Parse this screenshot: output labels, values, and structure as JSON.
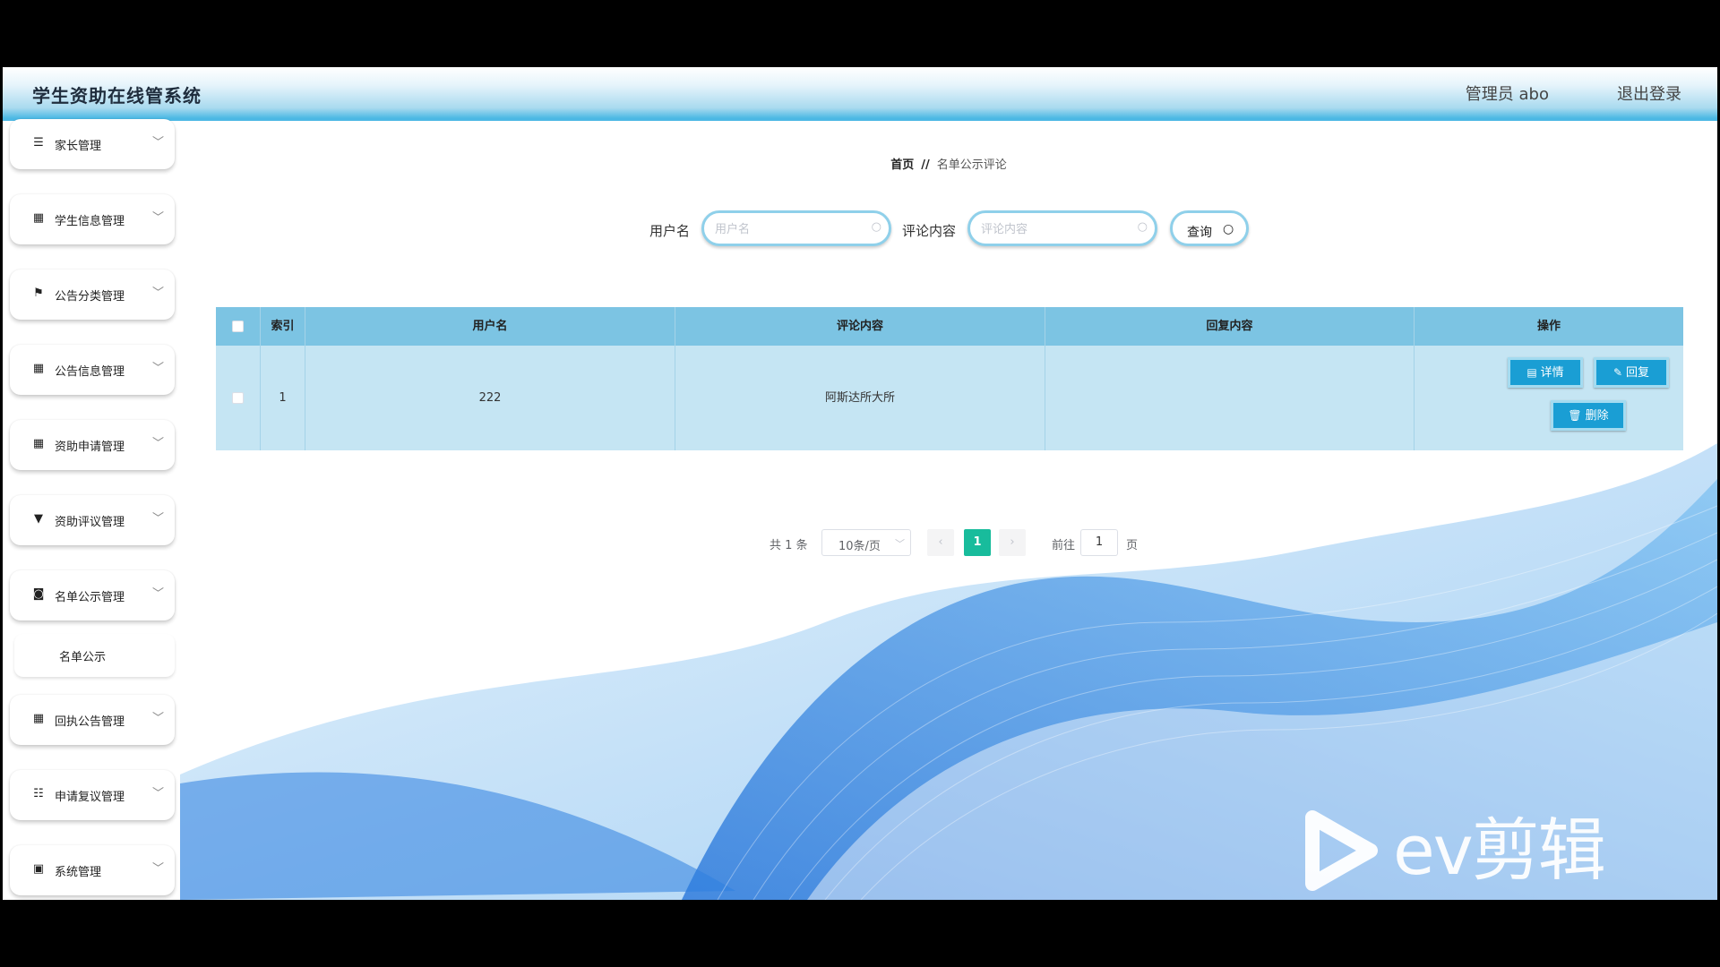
{
  "header": {
    "title": "学生资助在线管系统",
    "user": "管理员 abo",
    "logout": "退出登录"
  },
  "sidebar": {
    "items": [
      {
        "label": "家长管理",
        "icon": "list-icon",
        "glyph": "☰"
      },
      {
        "label": "学生信息管理",
        "icon": "grid-icon",
        "glyph": "▦"
      },
      {
        "label": "公告分类管理",
        "icon": "flag-icon",
        "glyph": "⚑"
      },
      {
        "label": "公告信息管理",
        "icon": "grid-icon",
        "glyph": "▦"
      },
      {
        "label": "资助申请管理",
        "icon": "grid-icon",
        "glyph": "▦"
      },
      {
        "label": "资助评议管理",
        "icon": "trophy-icon",
        "glyph": "▼"
      },
      {
        "label": "名单公示管理",
        "icon": "camera-icon",
        "glyph": "◙"
      },
      {
        "label": "回执公告管理",
        "icon": "grid-icon",
        "glyph": "▦"
      },
      {
        "label": "申请复议管理",
        "icon": "sliders-icon",
        "glyph": "☷"
      },
      {
        "label": "系统管理",
        "icon": "clipboard-icon",
        "glyph": "▣"
      }
    ],
    "submenu": "名单公示"
  },
  "breadcrumb": {
    "home": "首页",
    "sep": "//",
    "current": "名单公示评论"
  },
  "search": {
    "username_label": "用户名",
    "username_placeholder": "用户名",
    "comment_label": "评论内容",
    "comment_placeholder": "评论内容",
    "query_label": "查询"
  },
  "table": {
    "headers": [
      "索引",
      "用户名",
      "评论内容",
      "回复内容",
      "操作"
    ],
    "rows": [
      {
        "index": "1",
        "username": "222",
        "comment": "阿斯达所大所",
        "reply": ""
      }
    ],
    "actions": {
      "detail": "详情",
      "reply": "回复",
      "delete": "删除"
    }
  },
  "pagination": {
    "total": "共 1 条",
    "page_size": "10条/页",
    "current_page": "1",
    "goto_label": "前往",
    "goto_value": "1",
    "page_label": "页"
  },
  "watermark": {
    "text": "ev剪辑"
  },
  "colors": {
    "header_accent": "#4cb8e4",
    "table_header": "#7cc4e3",
    "table_row": "#c5e5f3",
    "button": "#1a9ed4",
    "page_active": "#18bc9c"
  }
}
